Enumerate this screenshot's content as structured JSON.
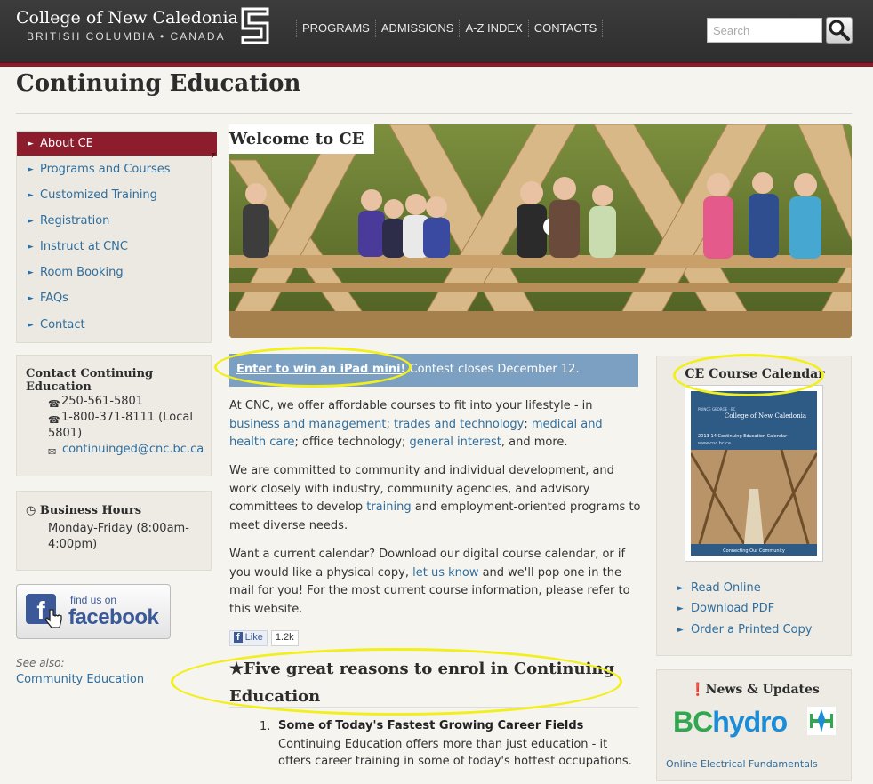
{
  "header": {
    "college_name": "College of New Caledonia",
    "college_sub": "BRITISH COLUMBIA • CANADA",
    "nav": [
      "PROGRAMS",
      "ADMISSIONS",
      "A-Z INDEX",
      "CONTACTS"
    ],
    "search_placeholder": "Search",
    "search_icon": "magnifier-icon"
  },
  "page_title": "Continuing Education",
  "sidebar": {
    "items": [
      {
        "label": "About CE",
        "active": true
      },
      {
        "label": "Programs and Courses"
      },
      {
        "label": "Customized Training"
      },
      {
        "label": "Registration"
      },
      {
        "label": "Instruct at CNC"
      },
      {
        "label": "Room Booking"
      },
      {
        "label": "FAQs"
      },
      {
        "label": "Contact"
      }
    ],
    "contact": {
      "heading": "Contact Continuing Education",
      "phone1": "250-561-5801",
      "phone2_a": "1-800-371-8111 (Local",
      "phone2_b": "5801)",
      "email": "continuinged@cnc.bc.ca"
    },
    "hours": {
      "heading": "Business Hours",
      "line1": "Monday-Friday (8:00am-",
      "line2": "4:00pm)"
    },
    "facebook": {
      "find_us": "find us on",
      "word": "facebook",
      "logo_letter": "f"
    },
    "see_also": "See also:",
    "community_link": "Community Education"
  },
  "main": {
    "welcome": "Welcome to CE",
    "contest_link": "Enter to win an iPad mini!",
    "contest_text": " Contest closes December 12.",
    "p1": {
      "t1": "At CNC, we offer affordable courses to fit into your lifestyle - in ",
      "l1": "business and management",
      "t2": "; ",
      "l2": "trades and technology",
      "t3": "; ",
      "l3": "medical and health care",
      "t4": "; office technology; ",
      "l4": "general interest",
      "t5": ", and more."
    },
    "p2": {
      "t1": "We are committed to community and individual development, and work closely with industry, community agencies, and advisory committees to develop ",
      "l1": "training",
      "t2": " and employment-oriented programs to meet diverse needs."
    },
    "p3": {
      "t1": "Want a current calendar? Download our digital course calendar, or if you would like a physical copy, ",
      "l1": "let us know",
      "t2": " and we'll pop one in the mail for you! For the most current course information, please refer to this website."
    },
    "like_label": "Like",
    "like_count": "1.2k",
    "reasons_heading": "Five great reasons to enrol in Continuing Education",
    "reasons": [
      {
        "num": "1.",
        "title": "Some of Today's Fastest Growing Career Fields",
        "body": "Continuing Education offers more than just education - it offers career training in some of today's hottest occupations."
      }
    ]
  },
  "right": {
    "calendar_heading": "CE Course Calendar",
    "cover": {
      "college": "College of New Caledonia",
      "location": "PRINCE GEORGE · BC",
      "title": "2013-14 Continuing Education Calendar",
      "url": "www.cnc.bc.ca",
      "tagline": "Connecting Our Community"
    },
    "links": [
      "Read Online",
      "Download PDF",
      "Order a Printed Copy"
    ],
    "news_heading": "News & Updates",
    "news_logo_bc": "BC",
    "news_logo_hydro": "hydro",
    "news_link": "Online Electrical Fundamentals"
  },
  "colors": {
    "accent": "#8d1d2c",
    "link": "#2f6e9e",
    "contest_bg": "#7ba0c1",
    "highlight": "#f2ef1b"
  }
}
